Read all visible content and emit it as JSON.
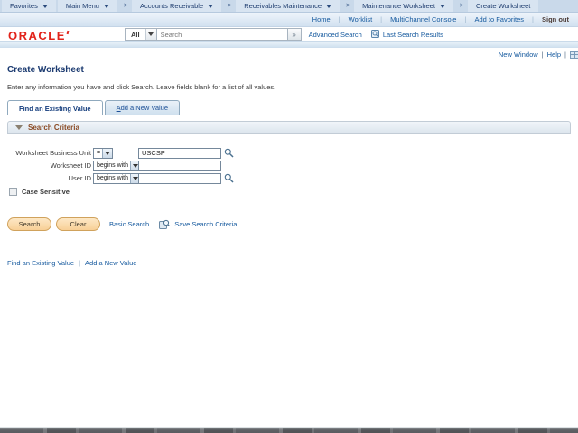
{
  "chars": {
    "crumb_sep": ">",
    "pipe": "|",
    "go": "»"
  },
  "breadcrumb": {
    "items": [
      {
        "label": "Favorites"
      },
      {
        "label": "Main Menu"
      },
      {
        "label": "Accounts Receivable"
      },
      {
        "label": "Receivables Maintenance"
      },
      {
        "label": "Maintenance Worksheet"
      },
      {
        "label": "Create Worksheet"
      }
    ]
  },
  "header_nav": {
    "home": "Home",
    "worklist": "Worklist",
    "multichannel": "MultiChannel Console",
    "add_to_favorites": "Add to Favorites",
    "sign_out": "Sign out"
  },
  "brand": {
    "logo_text": "ORACLE"
  },
  "search_bar": {
    "scope": "All",
    "placeholder": "Search",
    "advanced": "Advanced Search",
    "last_results": "Last Search Results"
  },
  "page_actions": {
    "new_window": "New Window",
    "help": "Help"
  },
  "page": {
    "title": "Create Worksheet",
    "instructions": "Enter any information you have and click Search. Leave fields blank for a list of all values."
  },
  "tabs": {
    "find_existing": "Find an Existing Value",
    "add_new": "Add a New Value"
  },
  "search_criteria": {
    "header": "Search Criteria",
    "rows": [
      {
        "label": "Worksheet Business Unit",
        "operator": "=",
        "value": "USCSP"
      },
      {
        "label": "Worksheet ID",
        "operator": "begins with",
        "value": ""
      },
      {
        "label": "User ID",
        "operator": "begins with",
        "value": ""
      }
    ],
    "case_sensitive": "Case Sensitive",
    "search_btn": "Search",
    "clear_btn": "Clear",
    "basic_search": "Basic Search",
    "save_search": "Save Search Criteria"
  },
  "footer_links": {
    "find_existing": "Find an Existing Value",
    "add_new": "Add a New Value"
  },
  "colors": {
    "oracle_red": "#e2231a",
    "link_blue": "#15599e",
    "title_navy": "#1b3a70",
    "criteria_brown": "#8a4a24",
    "button_peach": "#f8cf96",
    "header_blue": "#c9d9ea"
  }
}
